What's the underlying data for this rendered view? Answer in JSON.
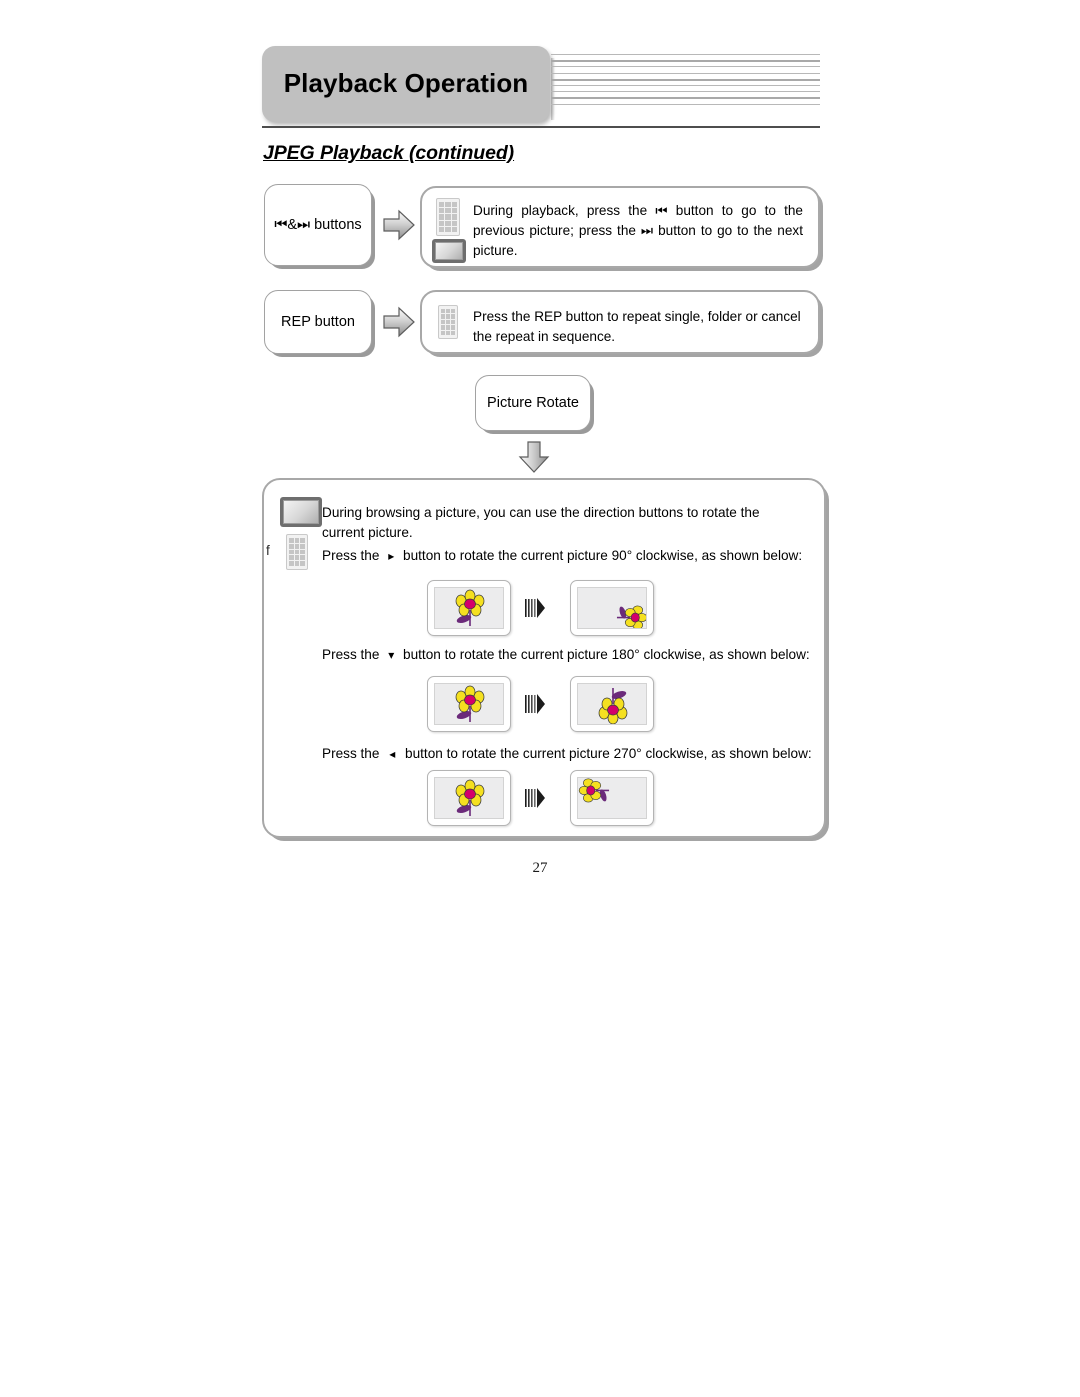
{
  "header": {
    "title": "Playback Operation",
    "decor_line_count": 9
  },
  "section": {
    "heading": "JPEG Playback (continued)"
  },
  "rows": [
    {
      "label": "⏮&⏭ buttons",
      "label_icon_prev": "skip-previous-icon",
      "label_icon_next": "skip-next-icon",
      "arrow_icon": "right-arrow-icon",
      "icons": [
        "remote-control-icon",
        "tv-screen-icon"
      ],
      "description": "During playback, press the ⏮ button to go to the previous picture; press the ⏭ button to go to the next picture."
    },
    {
      "label": "REP button",
      "arrow_icon": "right-arrow-icon",
      "icons": [
        "remote-control-icon"
      ],
      "description": "Press the REP button to repeat single, folder or cancel the repeat in sequence."
    }
  ],
  "picture_rotate": {
    "label": "Picture Rotate",
    "down_arrow_icon": "down-arrow-icon",
    "stray_char": "f",
    "icons": [
      "tv-screen-icon",
      "remote-control-icon"
    ],
    "intro": "During browsing a picture, you can use the direction buttons to rotate the current picture.",
    "steps": [
      {
        "prefix": "Press the",
        "button_glyph": "▸",
        "button_icon": "arrow-right-glyph-icon",
        "suffix": "button to rotate the current picture 90° clockwise, as shown below:",
        "degrees": 90,
        "before_alt": "upright-flower",
        "after_alt": "flower-rotated-90",
        "transition_icon": "motion-arrow-icon"
      },
      {
        "prefix": "Press the",
        "button_glyph": "▾",
        "button_icon": "arrow-down-glyph-icon",
        "suffix": "button to rotate the current picture 180° clockwise, as shown below:",
        "degrees": 180,
        "before_alt": "upright-flower",
        "after_alt": "flower-rotated-180",
        "transition_icon": "motion-arrow-icon"
      },
      {
        "prefix": "Press the",
        "button_glyph": "◂",
        "button_icon": "arrow-left-glyph-icon",
        "suffix": "button to rotate the current picture 270° clockwise, as shown below:",
        "degrees": 270,
        "before_alt": "upright-flower",
        "after_alt": "flower-rotated-270",
        "transition_icon": "motion-arrow-icon"
      }
    ]
  },
  "footer": {
    "page_number": "27"
  },
  "colors": {
    "header_box_bg": "#c0c0c0",
    "rule": "#4d4d4d",
    "box_border": "#a8a8a8",
    "flower_petal": "#f5e020",
    "flower_center": "#d4006a",
    "flower_stem": "#6b2a7a",
    "tv_body": "#6e6e6e"
  }
}
